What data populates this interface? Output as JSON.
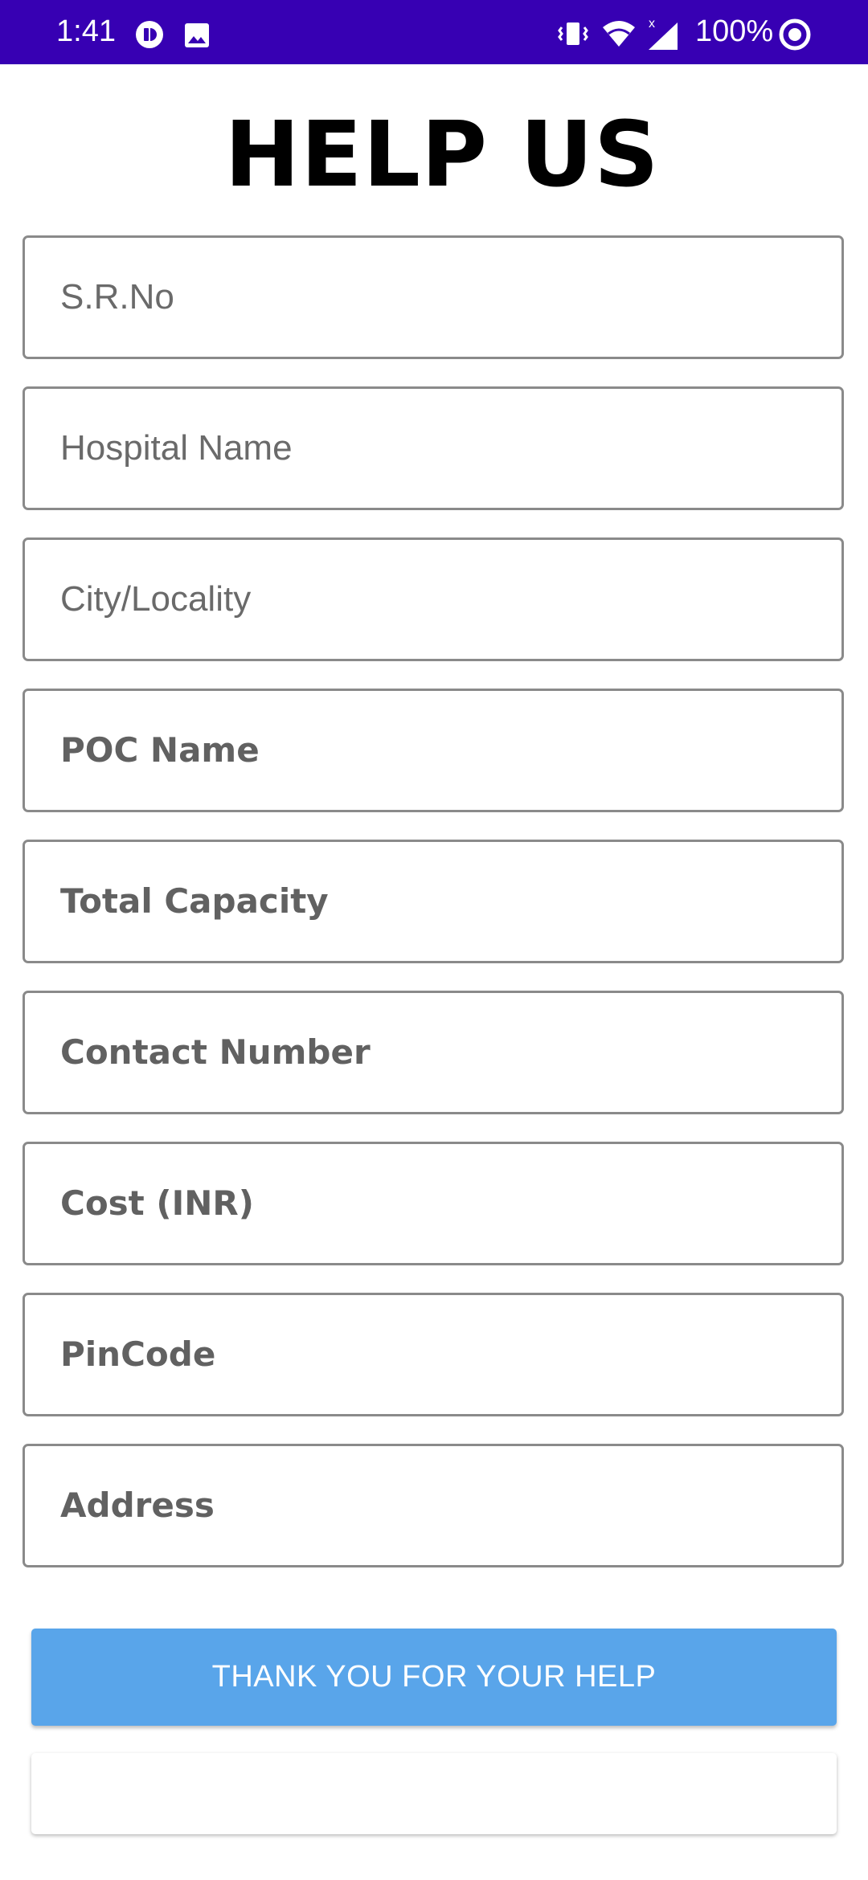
{
  "status_bar": {
    "time": "1:41",
    "battery_percent": "100%",
    "background_color": "#3700b3",
    "left_icons": [
      "record-icon",
      "image-icon"
    ],
    "right_icons": [
      "vibrate-icon",
      "wifi-icon",
      "signal-icon",
      "battery-ring-icon"
    ]
  },
  "page": {
    "title": "HELP US"
  },
  "form": {
    "fields": [
      {
        "placeholder": "S.R.No",
        "value": ""
      },
      {
        "placeholder": "Hospital Name",
        "value": ""
      },
      {
        "placeholder": "City/Locality",
        "value": ""
      },
      {
        "placeholder": "POC Name",
        "value": ""
      },
      {
        "placeholder": "Total Capacity",
        "value": ""
      },
      {
        "placeholder": "Contact Number",
        "value": ""
      },
      {
        "placeholder": "Cost (INR)",
        "value": ""
      },
      {
        "placeholder": "PinCode",
        "value": ""
      },
      {
        "placeholder": "Address",
        "value": ""
      }
    ],
    "submit_label": "THANK YOU FOR YOUR HELP",
    "submit_color": "#59a5ea"
  }
}
